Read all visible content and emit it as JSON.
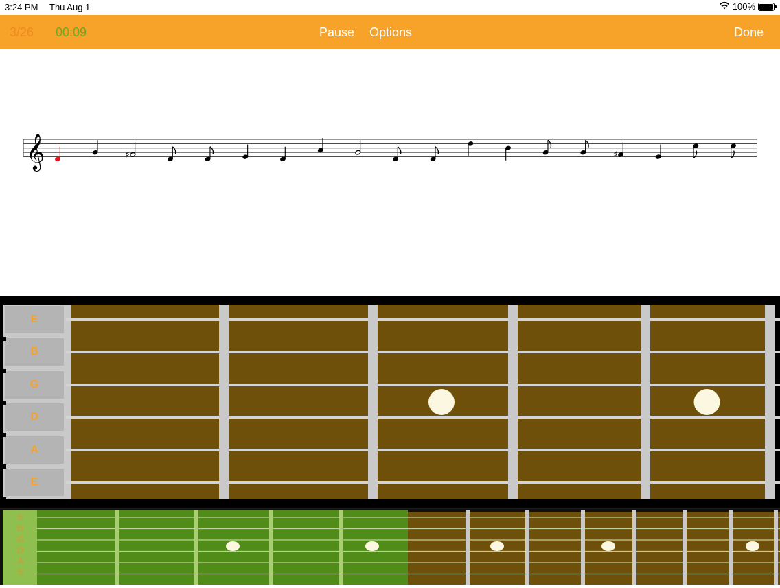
{
  "status_bar": {
    "time": "3:24 PM",
    "date": "Thu Aug 1",
    "battery": "100%",
    "wifi_icon": "wifi-icon",
    "battery_icon": "battery-icon"
  },
  "toolbar": {
    "counter": "3/26",
    "timer": "00:09",
    "pause_label": "Pause",
    "options_label": "Options",
    "done_label": "Done"
  },
  "score": {
    "clef": "treble",
    "notes": [
      {
        "pitch": "D4",
        "duration": "quarter",
        "accidental": "",
        "current": true
      },
      {
        "pitch": "G4",
        "duration": "quarter",
        "accidental": ""
      },
      {
        "pitch": "F#4",
        "duration": "half",
        "accidental": "sharp"
      },
      {
        "pitch": "D4",
        "duration": "eighth",
        "accidental": ""
      },
      {
        "pitch": "D4",
        "duration": "eighth",
        "accidental": ""
      },
      {
        "pitch": "E4",
        "duration": "quarter",
        "accidental": ""
      },
      {
        "pitch": "D4",
        "duration": "quarter",
        "accidental": ""
      },
      {
        "pitch": "A4",
        "duration": "quarter",
        "accidental": ""
      },
      {
        "pitch": "G4",
        "duration": "half",
        "accidental": ""
      },
      {
        "pitch": "D4",
        "duration": "eighth",
        "accidental": ""
      },
      {
        "pitch": "D4",
        "duration": "eighth",
        "accidental": ""
      },
      {
        "pitch": "D5",
        "duration": "quarter",
        "accidental": ""
      },
      {
        "pitch": "B4",
        "duration": "quarter",
        "accidental": ""
      },
      {
        "pitch": "G4",
        "duration": "eighth",
        "accidental": ""
      },
      {
        "pitch": "G4",
        "duration": "eighth",
        "accidental": ""
      },
      {
        "pitch": "F#4",
        "duration": "quarter",
        "accidental": "sharp"
      },
      {
        "pitch": "E4",
        "duration": "quarter",
        "accidental": ""
      },
      {
        "pitch": "C5",
        "duration": "eighth",
        "accidental": ""
      },
      {
        "pitch": "C5",
        "duration": "eighth",
        "accidental": ""
      }
    ]
  },
  "fretboard": {
    "strings": [
      "E",
      "B",
      "G",
      "D",
      "A",
      "E"
    ],
    "inlay_frets": [
      3,
      5
    ],
    "colors": {
      "wood": "#6e500a",
      "fret": "#c9c9c9",
      "label": "#f7a229",
      "inlay": "#fbf7e0"
    }
  },
  "mini_fretboard": {
    "strings": [
      "E",
      "B",
      "G",
      "D",
      "A",
      "E"
    ],
    "inlay_frets": [
      3,
      5,
      7,
      9,
      12
    ],
    "visible_frets": 5,
    "colors": {
      "highlight": "#4f8c18",
      "wood": "#6e500a"
    }
  },
  "colors": {
    "accent": "#f7a229",
    "timer": "#6aa82a",
    "current_note": "#e8121b"
  }
}
